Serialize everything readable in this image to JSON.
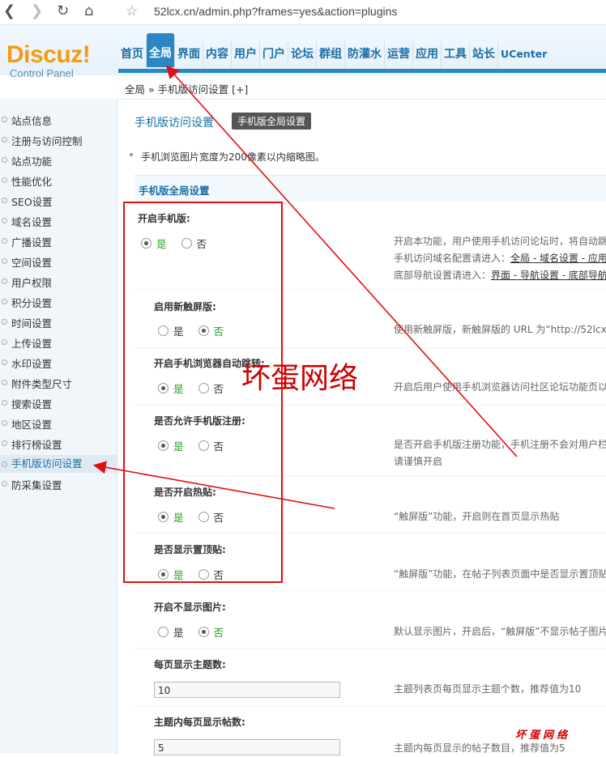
{
  "browser": {
    "url": "52lcx.cn/admin.php?frames=yes&action=plugins"
  },
  "header": {
    "logo": "Discuz!",
    "logo_sub": "Control Panel",
    "menu": [
      "首页",
      "全局",
      "界面",
      "内容",
      "用户",
      "门户",
      "论坛",
      "群组",
      "防灌水",
      "运营",
      "应用",
      "工具",
      "站长",
      "UCenter"
    ],
    "active_menu": "全局"
  },
  "breadcrumb": "全局 » 手机版访问设置 [+]",
  "sidebar": {
    "items": [
      "站点信息",
      "注册与访问控制",
      "站点功能",
      "性能优化",
      "SEO设置",
      "域名设置",
      "广播设置",
      "空间设置",
      "用户权限",
      "积分设置",
      "时间设置",
      "上传设置",
      "水印设置",
      "附件类型尺寸",
      "搜索设置",
      "地区设置",
      "排行榜设置",
      "手机版访问设置",
      "防采集设置"
    ],
    "active": "手机版访问设置"
  },
  "main": {
    "title": "手机版访问设置",
    "tag": "手机版全局设置",
    "tip": "手机浏览图片宽度为200像素以内缩略图。",
    "section": "手机版全局设置",
    "rows": [
      {
        "title": "开启手机版:",
        "yes": "是",
        "no": "否",
        "selected": "yes",
        "desc1": "开启本功能，用户使用手机访问论坛时，将自动跳",
        "desc2a": "手机访问域名配置请进入：",
        "desc2b": "全局 - 域名设置 - 应用",
        "desc3a": "底部导航设置请进入：",
        "desc3b": "界面 - 导航设置 - 底部导航"
      },
      {
        "title": "启用新触屏版:",
        "yes": "是",
        "no": "否",
        "selected": "no",
        "desc1": "使用新触屏版，新触屏版的 URL 为“http://52lcx"
      },
      {
        "title": "开启手机浏览器自动跳转:",
        "yes": "是",
        "no": "否",
        "selected": "yes",
        "desc1": "开启后用户使用手机浏览器访问社区论坛功能页以"
      },
      {
        "title": "是否允许手机版注册:",
        "yes": "是",
        "no": "否",
        "selected": "yes",
        "desc1": "是否开启手机版注册功能，手机注册不会对用户栏",
        "desc2": "请谨慎开启"
      },
      {
        "title": "是否开启热贴:",
        "yes": "是",
        "no": "否",
        "selected": "yes",
        "desc1": "“触屏版”功能，开启则在首页显示热贴"
      },
      {
        "title": "是否显示置顶贴:",
        "yes": "是",
        "no": "否",
        "selected": "yes",
        "desc1": "“触屏版”功能，在帖子列表页面中是否显示置顶贴"
      },
      {
        "title": "开启不显示图片:",
        "yes": "是",
        "no": "否",
        "selected": "no",
        "desc1": "默认显示图片，开启后，“触屏版”不显示帖子图片"
      },
      {
        "title": "每页显示主题数:",
        "value": "10",
        "desc1": "主题列表页每页显示主题个数，推荐值为10"
      },
      {
        "title": "主题内每页显示帖数:",
        "value": "5",
        "desc1": "主题内每页显示的帖子数目，推荐值为5"
      }
    ]
  },
  "annotations": {
    "watermark": "坏蛋网络",
    "watermark_small": "坏蛋网络",
    "color": "#e01010"
  }
}
